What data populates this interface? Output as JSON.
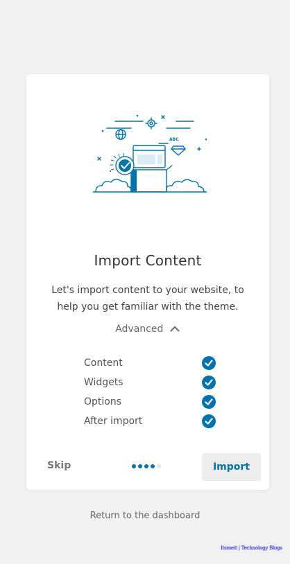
{
  "wizard": {
    "title": "Import Content",
    "description": "Let's import content to your website, to help you get familiar with the theme.",
    "advanced_label": "Advanced",
    "options": [
      {
        "label": "Content",
        "checked": true
      },
      {
        "label": "Widgets",
        "checked": true
      },
      {
        "label": "Options",
        "checked": true
      },
      {
        "label": "After import",
        "checked": true
      }
    ],
    "skip_label": "Skip",
    "import_label": "Import",
    "progress": {
      "total_steps": 5,
      "active_steps": 4
    },
    "illustration_text": "ABC"
  },
  "footer": {
    "return_label": "Return to the dashboard"
  },
  "watermark": "Itsmeit | Technology Blogs",
  "colors": {
    "accent": "#0073aa",
    "background": "#f1f1f1",
    "card": "#ffffff",
    "button_bg": "#ececec"
  }
}
